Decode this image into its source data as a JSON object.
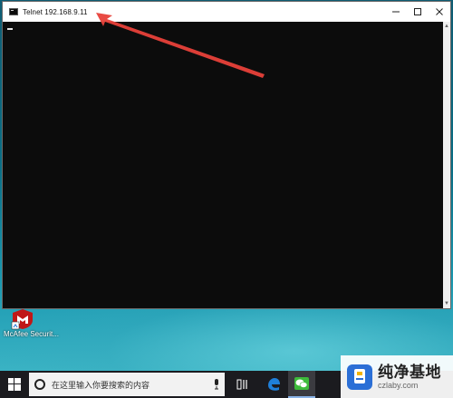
{
  "window": {
    "title": "Telnet 192.168.9.11",
    "minimize_icon": "minimize-icon",
    "maximize_icon": "maximize-icon",
    "close_icon": "close-icon"
  },
  "console": {
    "cursor": "_"
  },
  "desktop": {
    "icons": [
      {
        "label": "McAfee Securit...",
        "icon": "mcafee-icon"
      }
    ]
  },
  "taskbar": {
    "search_placeholder": "在这里输入你要搜索的内容",
    "task_view_label": "Ⅱ",
    "items": [
      {
        "icon": "task-view-icon"
      },
      {
        "icon": "edge-icon"
      },
      {
        "icon": "wechat-icon",
        "active": true
      }
    ]
  },
  "watermark": {
    "title": "纯净基地",
    "url": "czlaby.com"
  },
  "annotation": {
    "type": "red-arrow",
    "points_to": "window.title"
  },
  "colors": {
    "console_bg": "#0c0c0c",
    "titlebar_bg": "#ffffff",
    "taskbar_bg": "#1b1b1f",
    "arrow": "#e8413a",
    "accent_blue": "#2b6fd6"
  }
}
